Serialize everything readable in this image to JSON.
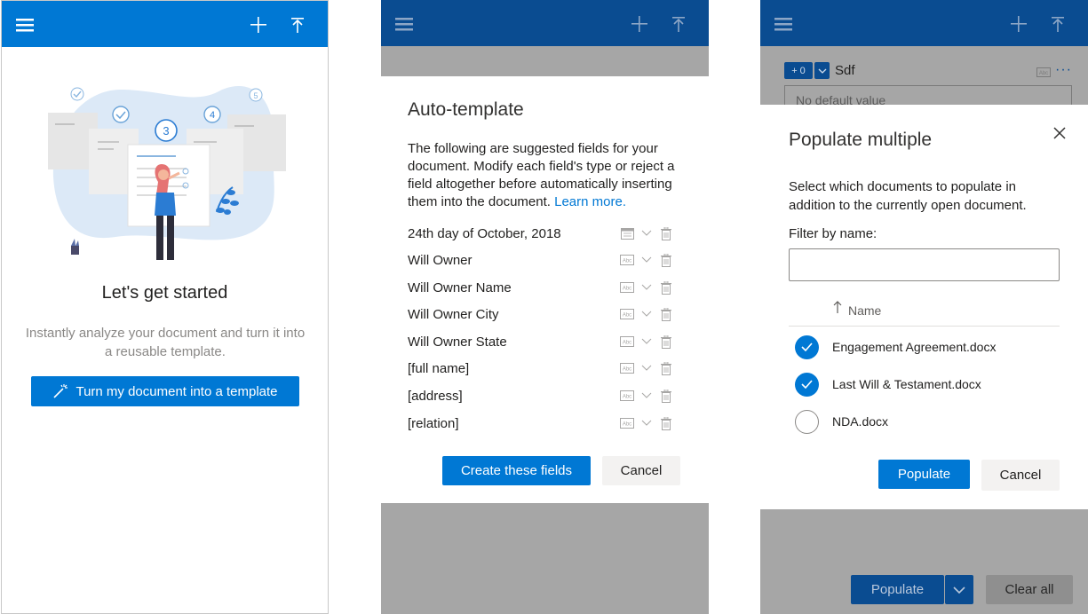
{
  "panel1": {
    "title": "Let's get started",
    "description": "Instantly analyze your document and turn it into a reusable template.",
    "button_label": "Turn my document into a template",
    "illustration_steps": [
      "3",
      "4",
      "5"
    ]
  },
  "panel2": {
    "dialog_title": "Auto-template",
    "description": "The following are suggested fields for your document. Modify each field's type or reject a field altogether before automatically inserting them into the document.",
    "learn_more": "Learn more.",
    "fields": [
      {
        "label": "24th day of October, 2018",
        "type_icon": "calendar-icon"
      },
      {
        "label": "Will Owner",
        "type_icon": "text-type-icon"
      },
      {
        "label": "Will Owner Name",
        "type_icon": "text-type-icon"
      },
      {
        "label": "Will Owner City",
        "type_icon": "text-type-icon"
      },
      {
        "label": "Will Owner State",
        "type_icon": "text-type-icon"
      },
      {
        "label": "[full name]",
        "type_icon": "text-type-icon"
      },
      {
        "label": "[address]",
        "type_icon": "text-type-icon"
      },
      {
        "label": "[relation]",
        "type_icon": "text-type-icon"
      }
    ],
    "create_button": "Create these fields",
    "cancel_button": "Cancel"
  },
  "panel3": {
    "background": {
      "counter": "+ 0",
      "field_name": "Sdf",
      "default_value_placeholder": "No default value",
      "more": "···",
      "populate_button": "Populate",
      "clear_all_button": "Clear all"
    },
    "dialog_title": "Populate multiple",
    "description": "Select which documents to populate in addition to the currently open document.",
    "filter_label": "Filter by name:",
    "filter_value": "",
    "column_header": "Name",
    "documents": [
      {
        "name": "Engagement Agreement.docx",
        "checked": true
      },
      {
        "name": "Last Will & Testament.docx",
        "checked": true
      },
      {
        "name": "NDA.docx",
        "checked": false
      }
    ],
    "populate_button": "Populate",
    "cancel_button": "Cancel"
  },
  "colors": {
    "brand_blue": "#0078d4",
    "header_dim": "#0a4c91",
    "overlay": "#a6a6a6"
  }
}
